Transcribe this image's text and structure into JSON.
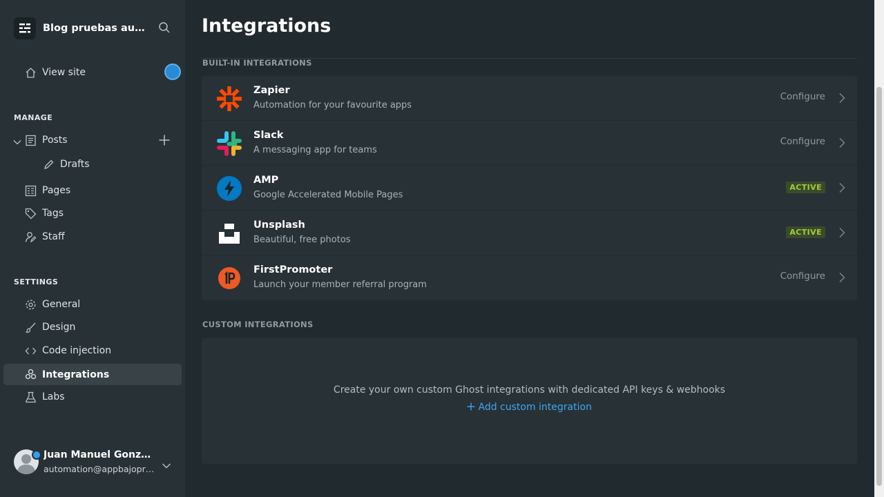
{
  "sidebar": {
    "site_title": "Blog pruebas automation",
    "view_site": "View site",
    "manage_heading": "MANAGE",
    "settings_heading": "SETTINGS",
    "manage_items": {
      "posts": "Posts",
      "drafts": "Drafts",
      "pages": "Pages",
      "tags": "Tags",
      "staff": "Staff"
    },
    "settings_items": {
      "general": "General",
      "design": "Design",
      "code_injection": "Code injection",
      "integrations": "Integrations",
      "labs": "Labs"
    },
    "user": {
      "name": "Juan Manuel González",
      "email": "automation@appbajopruebas.com"
    }
  },
  "main": {
    "title": "Integrations",
    "builtin_heading": "BUILT-IN INTEGRATIONS",
    "custom_heading": "CUSTOM INTEGRATIONS",
    "integrations": [
      {
        "name": "Zapier",
        "description": "Automation for your favourite apps",
        "status": "Configure",
        "icon": "zapier-icon"
      },
      {
        "name": "Slack",
        "description": "A messaging app for teams",
        "status": "Configure",
        "icon": "slack-icon"
      },
      {
        "name": "AMP",
        "description": "Google Accelerated Mobile Pages",
        "status": "ACTIVE",
        "icon": "amp-icon"
      },
      {
        "name": "Unsplash",
        "description": "Beautiful, free photos",
        "status": "ACTIVE",
        "icon": "unsplash-icon"
      },
      {
        "name": "FirstPromoter",
        "description": "Launch your member referral program",
        "status": "Configure",
        "icon": "firstpromoter-icon"
      }
    ],
    "custom_description": "Create your own custom Ghost integrations with dedicated API keys & webhooks",
    "custom_add": "Add custom integration"
  },
  "colors": {
    "accent": "#3ea6f2",
    "active_badge": "#9fce3c",
    "sidebar_bg": "#283136",
    "main_bg": "#212a2e"
  }
}
